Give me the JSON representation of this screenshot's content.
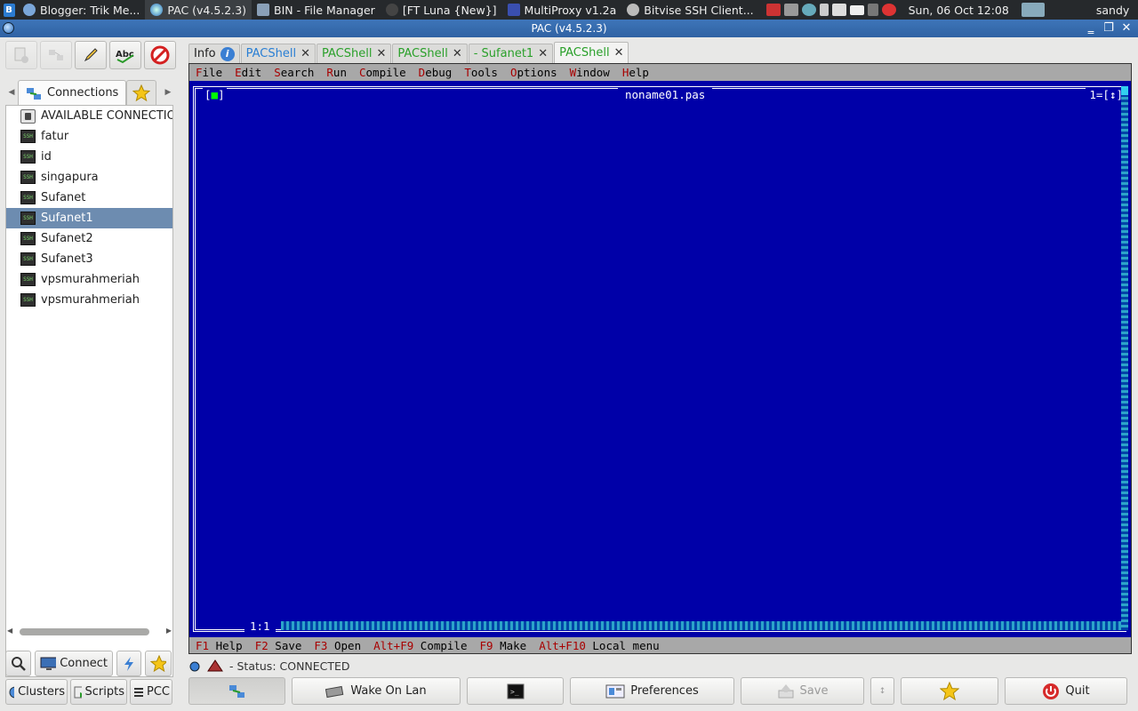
{
  "taskbar": {
    "tasks": [
      {
        "label": "Blogger: Trik Me..."
      },
      {
        "label": "PAC (v4.5.2.3)"
      },
      {
        "label": "BIN - File Manager"
      },
      {
        "label": "[FT Luna {New}]"
      },
      {
        "label": "MultiProxy v1.2a"
      },
      {
        "label": "Bitvise SSH Client..."
      }
    ],
    "clock": "Sun, 06 Oct  12:08",
    "user": "sandy"
  },
  "window": {
    "title": "PAC (v4.5.2.3)"
  },
  "left_panel": {
    "tabs": {
      "connections": "Connections"
    },
    "tree": [
      {
        "label": "AVAILABLE CONNECTIONS",
        "icon": "group-icon"
      },
      {
        "label": "fatur",
        "icon": "ssh-icon"
      },
      {
        "label": "id",
        "icon": "ssh-icon"
      },
      {
        "label": "singapura",
        "icon": "ssh-icon"
      },
      {
        "label": "Sufanet",
        "icon": "ssh-icon"
      },
      {
        "label": "Sufanet1",
        "icon": "ssh-icon",
        "selected": true
      },
      {
        "label": "Sufanet2",
        "icon": "ssh-icon"
      },
      {
        "label": "Sufanet3",
        "icon": "ssh-icon"
      },
      {
        "label": "vpsmurahmeriah",
        "icon": "ssh-icon"
      },
      {
        "label": "vpsmurahmeriah",
        "icon": "ssh-icon"
      }
    ],
    "connect_label": "Connect",
    "clusters_label": "Clusters",
    "scripts_label": "Scripts",
    "pcc_label": "PCC"
  },
  "tabs": [
    {
      "label": "Info",
      "color": "#333333"
    },
    {
      "label": "PACShell",
      "color": "#2a7fd4"
    },
    {
      "label": "PACShell",
      "color": "#2aa02a"
    },
    {
      "label": "PACShell",
      "color": "#2aa02a"
    },
    {
      "label": "- Sufanet1",
      "color": "#2aa02a"
    },
    {
      "label": "PACShell",
      "color": "#2aa02a"
    }
  ],
  "terminal": {
    "menu": [
      "File",
      "Edit",
      "Search",
      "Run",
      "Compile",
      "Debug",
      "Tools",
      "Options",
      "Window",
      "Help"
    ],
    "filename": "noname01.pas",
    "window_number": "1=[↕]",
    "close_box": "[■]",
    "cursor_pos": "1:1",
    "status_keys": [
      {
        "key": "F1",
        "label": "Help"
      },
      {
        "key": "F2",
        "label": "Save"
      },
      {
        "key": "F3",
        "label": "Open"
      },
      {
        "key": "Alt+F9",
        "label": "Compile"
      },
      {
        "key": "F9",
        "label": "Make"
      },
      {
        "key": "Alt+F10",
        "label": "Local menu"
      }
    ],
    "colors": {
      "editor_bg": "#0000a8",
      "menu_bg": "#a8a8a8",
      "hotkey": "#a80000"
    }
  },
  "status": "- Status: CONNECTED",
  "bottom_bar": {
    "wake_on_lan": "Wake On Lan",
    "preferences": "Preferences",
    "save": "Save",
    "quit": "Quit"
  }
}
